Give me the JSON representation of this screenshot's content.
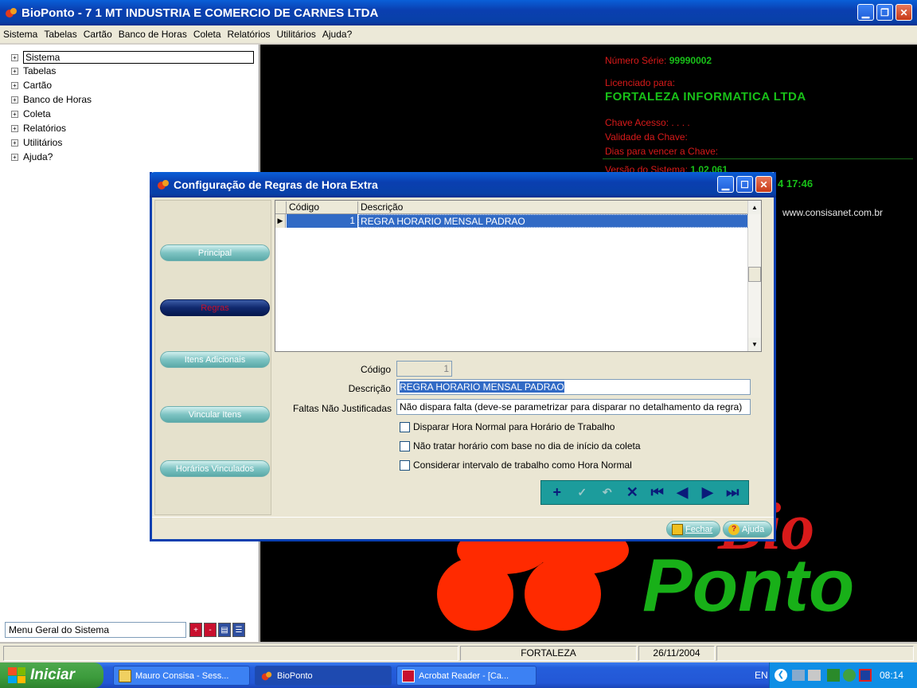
{
  "window": {
    "title": "BioPonto - 7 1 MT INDUSTRIA E COMERCIO DE CARNES LTDA"
  },
  "menubar": [
    "Sistema",
    "Tabelas",
    "Cartão",
    "Banco de Horas",
    "Coleta",
    "Relatórios",
    "Utilitários",
    "Ajuda?"
  ],
  "tree": {
    "items": [
      "Sistema",
      "Tabelas",
      "Cartão",
      "Banco de Horas",
      "Coleta",
      "Relatórios",
      "Utilitários",
      "Ajuda?"
    ],
    "bottom_label": "Menu Geral do Sistema"
  },
  "info": {
    "serial_label": "Número Série:",
    "serial_value": "99990002",
    "licensed_label": "Licenciado para:",
    "licensee": "FORTALEZA INFORMATICA LTDA",
    "key_label": "Chave Acesso:",
    "key_value": ". . . .",
    "validity_label": "Validade da Chave:",
    "days_label": "Dias para vencer a Chave:",
    "version_label": "Versão do Sistema:",
    "version_value": "1.02.061",
    "clock_partial": "4 17:46",
    "website": "www.consisanet.com.br",
    "logo_bio": "Bio",
    "logo_ponto": "Ponto"
  },
  "dialog": {
    "title": "Configuração de Regras de Hora Extra",
    "nav": [
      "Principal",
      "Regras",
      "Itens Adicionais",
      "Vincular Itens",
      "Horários Vinculados"
    ],
    "grid": {
      "columns": [
        "Código",
        "Descrição"
      ],
      "rows": [
        {
          "codigo": "1",
          "descricao": "REGRA HORARIO MENSAL PADRAO"
        }
      ]
    },
    "form": {
      "codigo_label": "Código",
      "codigo_value": "1",
      "descricao_label": "Descrição",
      "descricao_value": "REGRA HORARIO MENSAL PADRAO",
      "faltas_label": "Faltas Não Justificadas",
      "faltas_value": "Não dispara falta (deve-se parametrizar para disparar no detalhamento da regra)",
      "checkboxes": [
        "Disparar Hora Normal para Horário de Trabalho",
        "Não tratar horário com base no dia de início da coleta",
        "Considerar intervalo de trabalho como Hora Normal"
      ]
    },
    "buttons": {
      "fechar": "Fechar",
      "ajuda": "Ajuda"
    }
  },
  "status": {
    "city": "FORTALEZA",
    "date": "26/11/2004"
  },
  "taskbar": {
    "start": "Iniciar",
    "tasks": [
      "Mauro Consisa - Sess...",
      "BioPonto",
      "Acrobat Reader - [Ca..."
    ],
    "lang": "EN",
    "clock": "08:14"
  },
  "colors": {
    "accent_red": "#d81a1a",
    "accent_green": "#18c018",
    "selection_blue": "#316ac5",
    "title_blue": "#0a3fb0"
  }
}
